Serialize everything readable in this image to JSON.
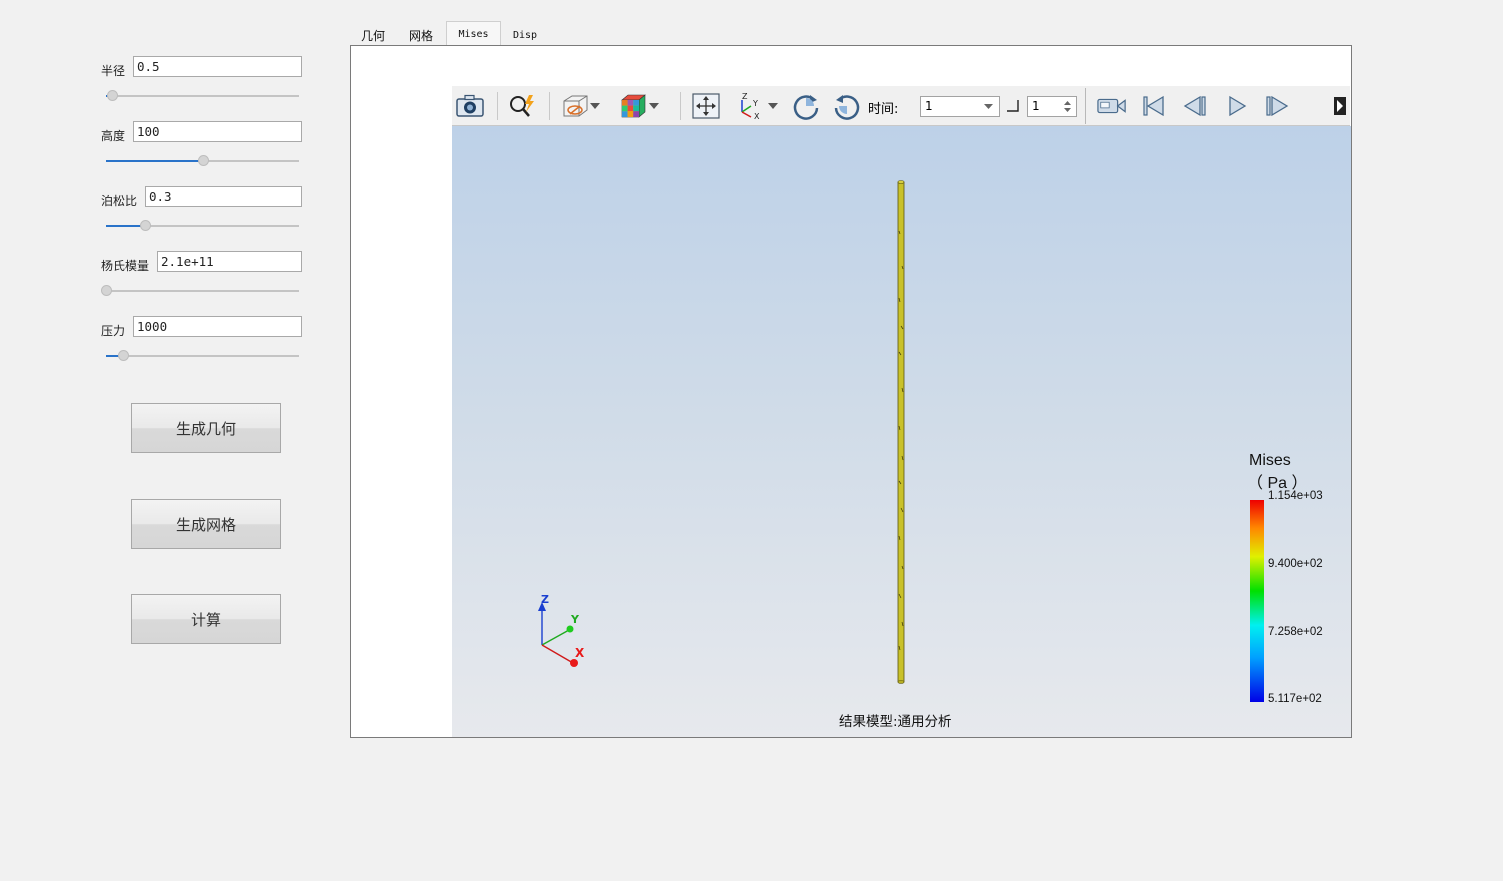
{
  "params": [
    {
      "label": "半径",
      "value": "0.5",
      "slider": 0.03
    },
    {
      "label": "高度",
      "value": "100",
      "slider": 0.5
    },
    {
      "label": "泊松比",
      "value": "0.3",
      "slider": 0.2
    },
    {
      "label": "杨氏模量",
      "value": "2.1e+11",
      "slider": 0.0
    },
    {
      "label": "压力",
      "value": "1000",
      "slider": 0.09
    }
  ],
  "buttons": {
    "geometry": "生成几何",
    "mesh": "生成网格",
    "compute": "计算"
  },
  "tabs": [
    "几何",
    "网格",
    "Mises",
    "Disp"
  ],
  "active_tab": "Mises",
  "toolbar": {
    "time_label": "时间:",
    "time_value": "1",
    "step_value": "1",
    "icons": [
      "camera-icon",
      "query-icon",
      "surface-display-icon",
      "color-cube-icon",
      "fit-view-icon",
      "axes-orientation-icon",
      "rotate-cw-icon",
      "rotate-ccw-icon",
      "record-video-icon",
      "first-frame-icon",
      "prev-frame-icon",
      "play-icon",
      "next-frame-icon",
      "toolbar-overflow-icon"
    ]
  },
  "viewport": {
    "status": "结果模型:通用分析",
    "legend": {
      "title": "Mises",
      "unit": "（ Pa ）",
      "labels": [
        "1.154e+03",
        "9.400e+02",
        "7.258e+02",
        "5.117e+02"
      ]
    },
    "axes": {
      "z": "Z",
      "y": "Y",
      "x": "X"
    },
    "colors": {
      "model": "#c9c12a",
      "bg_top": "#bdd1e8",
      "bg_bottom": "#e7e9ed"
    }
  }
}
